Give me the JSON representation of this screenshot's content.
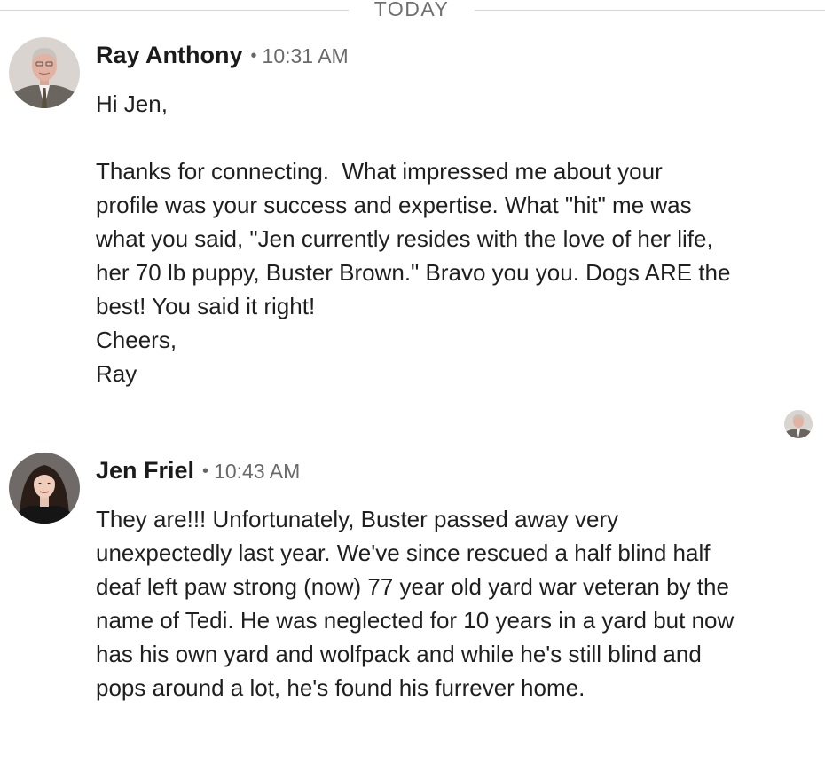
{
  "divider": {
    "label": "TODAY"
  },
  "messages": [
    {
      "sender": "Ray Anthony",
      "separator": "•",
      "time": "10:31 AM",
      "lines": [
        "Hi Jen,",
        "",
        "Thanks for connecting.  What impressed me about your",
        "profile was your success and expertise. What \"hit\" me was",
        "what you said, \"Jen currently resides with the love of her life,",
        "her 70 lb puppy, Buster Brown.\" Bravo you you. Dogs ARE the",
        "best! You said it right!",
        "Cheers,",
        "Ray"
      ]
    },
    {
      "sender": "Jen Friel",
      "separator": "•",
      "time": "10:43 AM",
      "lines": [
        "They are!!! Unfortunately, Buster passed away very",
        "unexpectedly last year. We've since rescued a half blind half",
        "deaf left paw strong (now) 77 year old yard war veteran by the",
        "name of Tedi. He was neglected for 10 years in a yard but now",
        "has his own yard and wolfpack and while he's still blind and",
        "pops around a lot, he's found his furrever home."
      ]
    }
  ],
  "icons": {
    "avatar_ray": "avatar-photo-icon",
    "avatar_jen": "avatar-photo-icon",
    "read_receipt": "read-receipt-avatar-icon"
  }
}
